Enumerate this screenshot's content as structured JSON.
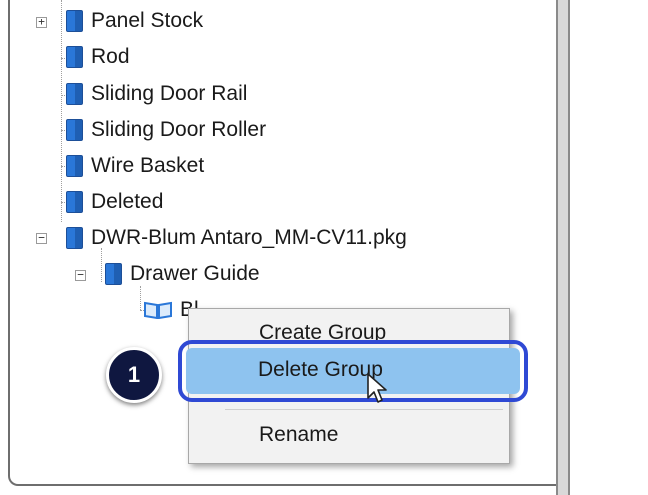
{
  "tree": {
    "items": [
      {
        "label": "Panel Stock",
        "icon": "book-icon",
        "expander": "+"
      },
      {
        "label": "Rod",
        "icon": "book-icon"
      },
      {
        "label": "Sliding Door Rail",
        "icon": "book-icon"
      },
      {
        "label": "Sliding Door Roller",
        "icon": "book-icon"
      },
      {
        "label": "Wire Basket",
        "icon": "book-icon"
      },
      {
        "label": "Deleted",
        "icon": "book-icon"
      },
      {
        "label": "DWR-Blum Antaro_MM-CV11.pkg",
        "icon": "book-icon",
        "expander": "−"
      },
      {
        "label": "Drawer Guide",
        "icon": "book-icon",
        "expander": "−"
      },
      {
        "label": "Bl",
        "icon": "open-book-icon"
      }
    ]
  },
  "context_menu": {
    "items": [
      "Create Group",
      "Delete Group",
      "Rename"
    ],
    "selected": "Delete Group"
  },
  "callout": {
    "step": "1"
  },
  "colors": {
    "book_blue": "#2a77d8",
    "highlight_border": "#2f49d4",
    "selection_fill": "#8ec3ef",
    "badge": "#0f1740"
  }
}
